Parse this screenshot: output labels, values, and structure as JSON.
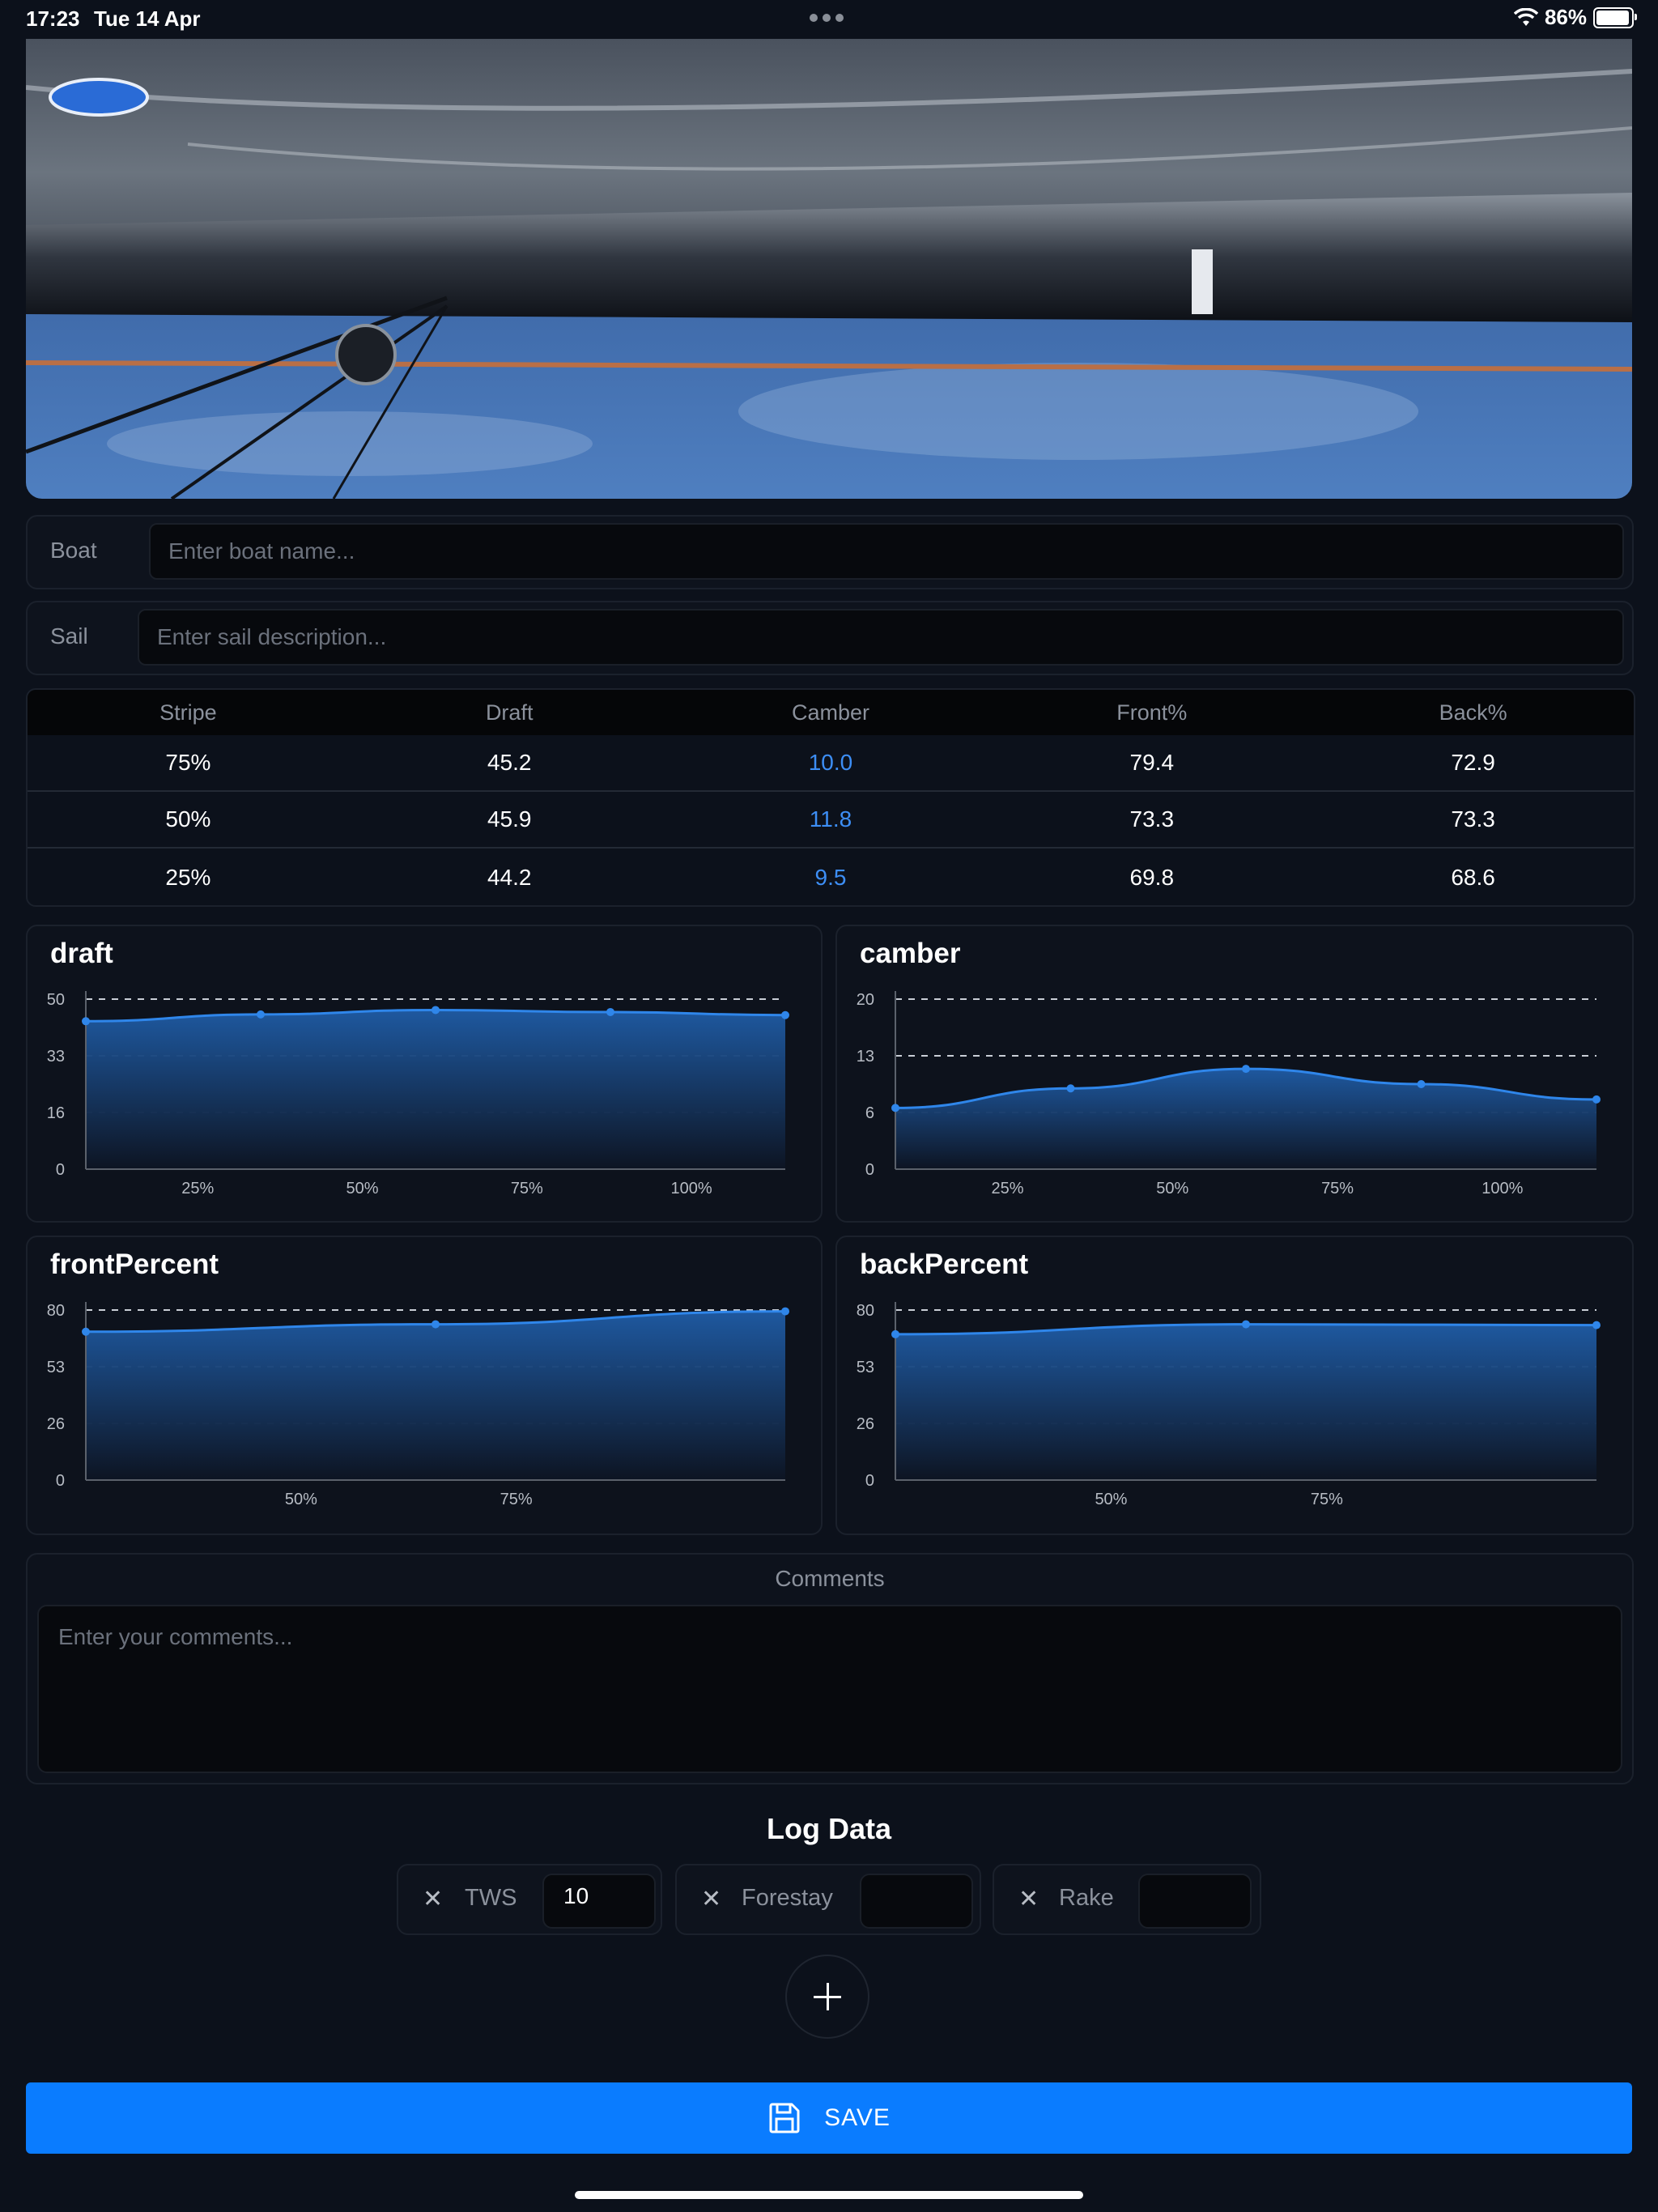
{
  "status_bar": {
    "time": "17:23",
    "date": "Tue 14 Apr",
    "battery": "86%",
    "battery_level": 0.86
  },
  "boat": {
    "label": "Boat",
    "placeholder": "Enter boat name..."
  },
  "sail": {
    "label": "Sail",
    "placeholder": "Enter sail description..."
  },
  "table": {
    "headers": [
      "Stripe",
      "Draft",
      "Camber",
      "Front%",
      "Back%"
    ],
    "rows": [
      [
        "75%",
        "45.2",
        "10.0",
        "79.4",
        "72.9"
      ],
      [
        "50%",
        "45.9",
        "11.8",
        "73.3",
        "73.3"
      ],
      [
        "25%",
        "44.2",
        "9.5",
        "69.8",
        "68.6"
      ]
    ]
  },
  "chart_data": [
    {
      "type": "area",
      "title": "draft",
      "x_ticks": [
        "25%",
        "50%",
        "75%",
        "100%"
      ],
      "y_ticks": [
        "50",
        "33",
        "16",
        "0"
      ],
      "ylim": [
        0,
        50
      ],
      "values": [
        43.5,
        45.5,
        46.8,
        46.2,
        45.3
      ],
      "grid": true,
      "color": "#2f86ea"
    },
    {
      "type": "area",
      "title": "camber",
      "x_ticks": [
        "25%",
        "50%",
        "75%",
        "100%"
      ],
      "y_ticks": [
        "20",
        "13",
        "6",
        "0"
      ],
      "ylim": [
        0,
        20
      ],
      "values": [
        7.2,
        9.5,
        11.8,
        10.0,
        8.2
      ],
      "grid": true,
      "color": "#2f86ea"
    },
    {
      "type": "area",
      "title": "frontPercent",
      "x_ticks": [
        "50%",
        "75%"
      ],
      "y_ticks": [
        "80",
        "53",
        "26",
        "0"
      ],
      "ylim": [
        0,
        80
      ],
      "values": [
        69.8,
        73.3,
        79.4
      ],
      "grid": true,
      "color": "#2f86ea"
    },
    {
      "type": "area",
      "title": "backPercent",
      "x_ticks": [
        "50%",
        "75%"
      ],
      "y_ticks": [
        "80",
        "53",
        "26",
        "0"
      ],
      "ylim": [
        0,
        80
      ],
      "values": [
        68.6,
        73.3,
        72.9
      ],
      "grid": true,
      "color": "#2f86ea"
    }
  ],
  "comments": {
    "title": "Comments",
    "placeholder": "Enter your comments..."
  },
  "log": {
    "title": "Log Data",
    "items": [
      {
        "label": "TWS",
        "value": "10"
      },
      {
        "label": "Forestay",
        "value": ""
      },
      {
        "label": "Rake",
        "value": ""
      }
    ]
  },
  "save": {
    "label": "SAVE"
  },
  "colors": {
    "accent": "#0a7cff",
    "background": "#0c111b",
    "camber_value": "#3d8ef5"
  }
}
